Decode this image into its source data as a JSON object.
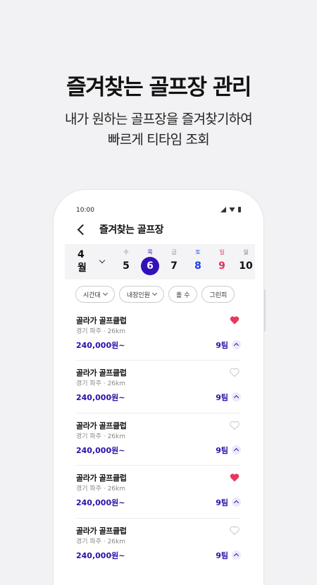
{
  "promo": {
    "headline": "즐겨찾는 골프장 관리",
    "subline1": "내가 원하는 골프장을 즐겨찾기하여",
    "subline2": "빠르게 티타임 조회"
  },
  "status_bar": {
    "time": "10:00"
  },
  "header": {
    "title": "즐겨찾는 골프장"
  },
  "date_selector": {
    "month": "4월",
    "days": [
      {
        "dow": "수",
        "num": "5",
        "selected": false,
        "color": "#111111",
        "dow_color": "#888888"
      },
      {
        "dow": "목",
        "num": "6",
        "selected": true,
        "color": "#ffffff",
        "dow_color": "#3311b8"
      },
      {
        "dow": "금",
        "num": "7",
        "selected": false,
        "color": "#111111",
        "dow_color": "#888888"
      },
      {
        "dow": "토",
        "num": "8",
        "selected": false,
        "color": "#1f3fe0",
        "dow_color": "#1f3fe0"
      },
      {
        "dow": "일",
        "num": "9",
        "selected": false,
        "color": "#e0345a",
        "dow_color": "#e0345a"
      },
      {
        "dow": "월",
        "num": "10",
        "selected": false,
        "color": "#111111",
        "dow_color": "#888888"
      }
    ]
  },
  "filters": [
    {
      "label": "시간대",
      "dropdown": true
    },
    {
      "label": "내장인원",
      "dropdown": true
    },
    {
      "label": "홀 수",
      "dropdown": false
    },
    {
      "label": "그린피",
      "dropdown": false
    }
  ],
  "courses": [
    {
      "name": "골라가 골프클럽",
      "location": "경기 파주 · 26km",
      "price": "240,000원~",
      "teams": "9팀",
      "favorited": true
    },
    {
      "name": "골라가 골프클럽",
      "location": "경기 파주 · 26km",
      "price": "240,000원~",
      "teams": "9팀",
      "favorited": false
    },
    {
      "name": "골라가 골프클럽",
      "location": "경기 파주 · 26km",
      "price": "240,000원~",
      "teams": "9팀",
      "favorited": false
    },
    {
      "name": "골라가 골프클럽",
      "location": "경기 파주 · 26km",
      "price": "240,000원~",
      "teams": "9팀",
      "favorited": true
    },
    {
      "name": "골라가 골프클럽",
      "location": "경기 파주 · 26km",
      "price": "240,000원~",
      "teams": "9팀",
      "favorited": false
    }
  ],
  "colors": {
    "accent": "#2b10a8",
    "selected_day": "#3311b8",
    "heart_on": "#e8395d",
    "heart_off": "#c8c8cc"
  }
}
